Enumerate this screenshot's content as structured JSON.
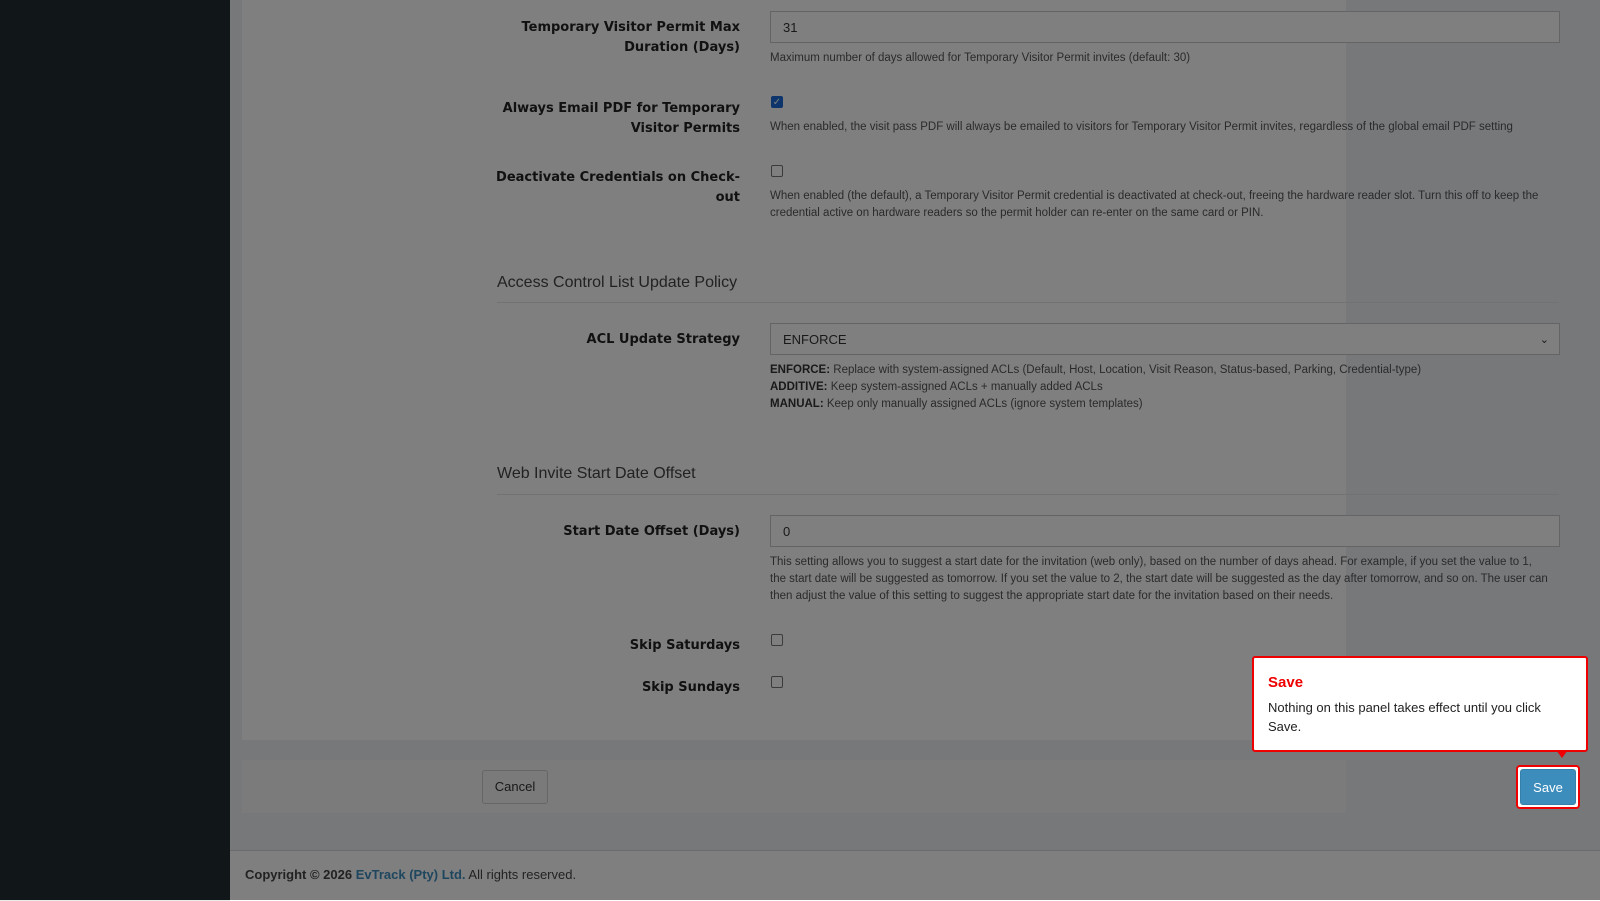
{
  "form": {
    "max_duration": {
      "label": "Temporary Visitor Permit Max Duration (Days)",
      "value": "31",
      "help": "Maximum number of days allowed for Temporary Visitor Permit invites (default: 30)"
    },
    "always_email_pdf": {
      "label": "Always Email PDF for Temporary Visitor Permits",
      "checked": true,
      "help": "When enabled, the visit pass PDF will always be emailed to visitors for Temporary Visitor Permit invites, regardless of the global email PDF setting"
    },
    "deactivate_credentials": {
      "label": "Deactivate Credentials on Check-out",
      "checked": false,
      "help": "When enabled (the default), a Temporary Visitor Permit credential is deactivated at check-out, freeing the hardware reader slot. Turn this off to keep the credential active on hardware readers so the permit holder can re-enter on the same card or PIN."
    },
    "acl_section": {
      "title": "Access Control List Update Policy",
      "strategy_label": "ACL Update Strategy",
      "strategy_value": "ENFORCE",
      "enforce_key": "ENFORCE:",
      "enforce_text": " Replace with system-assigned ACLs (Default, Host, Location, Visit Reason, Status-based, Parking, Credential-type)",
      "additive_key": "ADDITIVE:",
      "additive_text": " Keep system-assigned ACLs + manually added ACLs",
      "manual_key": "MANUAL:",
      "manual_text": " Keep only manually assigned ACLs (ignore system templates)"
    },
    "offset_section": {
      "title": "Web Invite Start Date Offset",
      "offset_label": "Start Date Offset (Days)",
      "offset_value": "0",
      "offset_help": "This setting allows you to suggest a start date for the invitation (web only), based on the number of days ahead. For example, if you set the value to 1, the start date will be suggested as tomorrow. If you set the value to 2, the start date will be suggested as the day after tomorrow, and so on. The user can then adjust the value of this setting to suggest the appropriate start date for the invitation based on their needs.",
      "skip_saturdays_label": "Skip Saturdays",
      "skip_saturdays_checked": false,
      "skip_sundays_label": "Skip Sundays",
      "skip_sundays_checked": false
    }
  },
  "buttons": {
    "cancel": "Cancel",
    "save": "Save"
  },
  "tooltip": {
    "title": "Save",
    "body": "Nothing on this panel takes effect until you click Save."
  },
  "footer": {
    "prefix": "Copyright © 2026 ",
    "company": "EvTrack (Pty) Ltd.",
    "suffix": " All rights reserved."
  },
  "colors": {
    "primary": "#3c8dbc",
    "highlight": "#ee0000",
    "sidebar": "#222d32"
  }
}
